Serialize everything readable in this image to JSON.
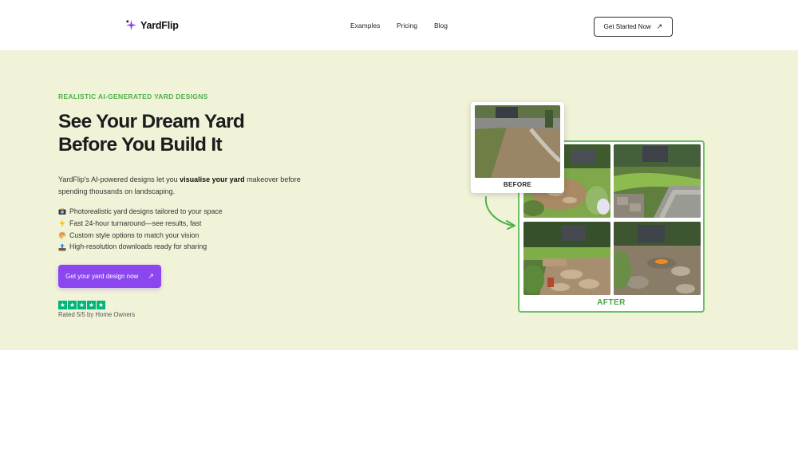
{
  "brand": {
    "name": "YardFlip",
    "accent": "#8b46f0"
  },
  "nav": {
    "examples": "Examples",
    "pricing": "Pricing",
    "blog": "Blog"
  },
  "header_cta": {
    "label": "Get Started Now",
    "icon": "arrow-up-right-icon"
  },
  "hero": {
    "eyebrow": "REALISTIC AI-GENERATED YARD DESIGNS",
    "headline_line1": "See Your Dream Yard",
    "headline_line2": "Before You Build It",
    "desc_pre": "YardFlip's AI-powered designs let you ",
    "desc_bold": "visualise your yard",
    "desc_post": " makeover before spending thousands on landscaping.",
    "features": [
      {
        "icon": "camera-flash-icon",
        "text": "Photorealistic yard designs tailored to your space"
      },
      {
        "icon": "lightning-icon",
        "text": "Fast 24-hour turnaround—see results, fast"
      },
      {
        "icon": "palette-icon",
        "text": "Custom style options to match your vision"
      },
      {
        "icon": "desktop-upload-icon",
        "text": "High-resolution downloads ready for sharing"
      }
    ],
    "cta_label": "Get your yard design now",
    "rating": {
      "stars": 5,
      "text": "Rated 5/5 by Home Owners",
      "color": "#00b67a"
    }
  },
  "collage": {
    "before_label": "BEFORE",
    "after_label": "AFTER",
    "after_color": "#49a644"
  },
  "colors": {
    "hero_bg": "#f1f3d9",
    "eyebrow": "#4fb04a"
  }
}
